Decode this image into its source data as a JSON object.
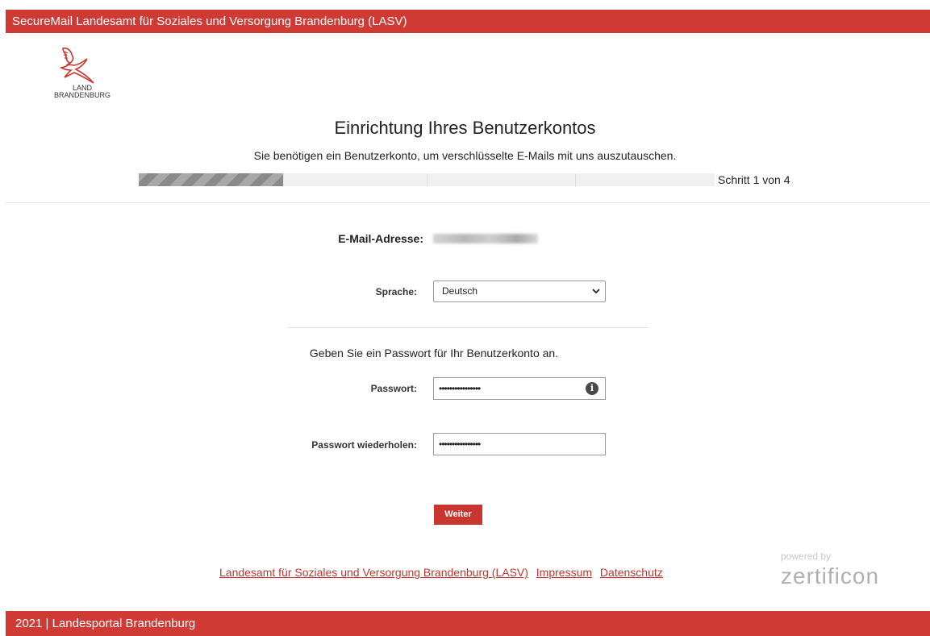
{
  "header": {
    "title": "SecureMail Landesamt für Soziales und Versorgung Brandenburg (LASV)"
  },
  "logo": {
    "line1": "LAND",
    "line2": "BRANDENBURG"
  },
  "page": {
    "title": "Einrichtung Ihres Benutzerkontos",
    "subtitle": "Sie benötigen ein Benutzerkonto, um verschlüsselte E-Mails mit uns auszutauschen."
  },
  "progress": {
    "step_label": "Schritt 1 von 4",
    "current_step": 1,
    "total_steps": 4
  },
  "form": {
    "email_label": "E-Mail-Adresse:",
    "language_label": "Sprache:",
    "language_value": "Deutsch",
    "instruction": "Geben Sie ein Passwort für Ihr Benutzerkonto an.",
    "password_label": "Passwort:",
    "password_value": "••••••••••••••••",
    "password_repeat_label": "Passwort wiederholen:",
    "password_repeat_value": "••••••••••••••••",
    "info_icon_glyph": "i",
    "submit_label": "Weiter"
  },
  "footer": {
    "links": [
      "Landesamt für Soziales und Versorgung Brandenburg (LASV)",
      "Impressum",
      "Datenschutz"
    ],
    "powered_by": "powered by",
    "brand": "zertificon",
    "copyright": "2021 | Landesportal Brandenburg"
  },
  "colors": {
    "accent": "#cf3a35",
    "link": "#c0362f"
  },
  "icons": [
    "eagle-logo-icon",
    "chevron-down-icon",
    "info-icon"
  ]
}
